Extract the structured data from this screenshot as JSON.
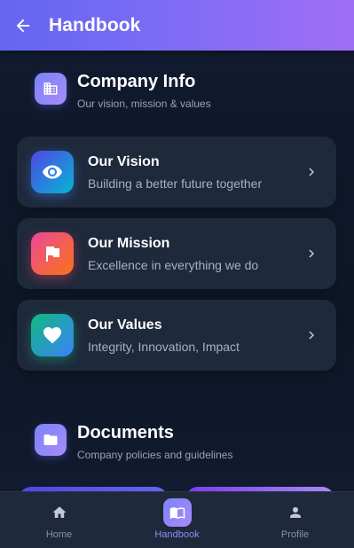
{
  "appbar": {
    "title": "Handbook"
  },
  "company_section": {
    "title": "Company Info",
    "subtitle": "Our vision, mission & values",
    "icon": "building-icon"
  },
  "cards": [
    {
      "title": "Our Vision",
      "subtitle": "Building a better future together",
      "icon": "eye-icon"
    },
    {
      "title": "Our Mission",
      "subtitle": "Excellence in everything we do",
      "icon": "flag-icon"
    },
    {
      "title": "Our Values",
      "subtitle": "Integrity, Innovation, Impact",
      "icon": "heart-icon"
    }
  ],
  "documents_section": {
    "title": "Documents",
    "subtitle": "Company policies and guidelines",
    "icon": "folder-icon"
  },
  "bottom_nav": [
    {
      "label": "Home",
      "icon": "home-icon",
      "active": false
    },
    {
      "label": "Handbook",
      "icon": "book-icon",
      "active": true
    },
    {
      "label": "Profile",
      "icon": "person-icon",
      "active": false
    }
  ],
  "colors": {
    "appbar_start": "#6366f1",
    "appbar_end": "#a06ef5",
    "background": "#0f172a",
    "card": "#1e293b",
    "active_nav": "#8b8ff8"
  }
}
